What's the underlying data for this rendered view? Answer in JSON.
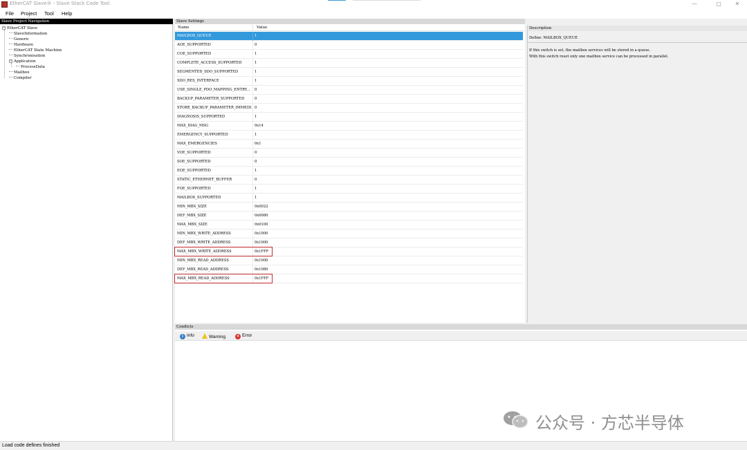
{
  "window": {
    "title": "EtherCAT Slave® - Slave Stack Code Tool",
    "controls": [
      "—",
      "□",
      "✕"
    ]
  },
  "menu": {
    "file": "File",
    "project": "Project",
    "tool": "Tool",
    "help": "Help"
  },
  "nav": {
    "header": "Slave Project Navigation",
    "items": [
      {
        "label": "EtherCAT Slave",
        "level": 0,
        "expander": "−"
      },
      {
        "label": "SlaveInformation",
        "level": 1
      },
      {
        "label": "Generic",
        "level": 1
      },
      {
        "label": "Hardware",
        "level": 1
      },
      {
        "label": "EtherCAT State Machine",
        "level": 1
      },
      {
        "label": "Synchronisation",
        "level": 1
      },
      {
        "label": "Application",
        "level": 1,
        "expander": "−"
      },
      {
        "label": "ProcessData",
        "level": 2
      },
      {
        "label": "Mailbox",
        "level": 1
      },
      {
        "label": "Compiler",
        "level": 1
      }
    ]
  },
  "settings": {
    "header": "Slave Settings",
    "col_name": "Name",
    "col_value": "Value",
    "rows": [
      {
        "name": "MAILBOX_QUEUE",
        "value": "1",
        "selected": true
      },
      {
        "name": "AOE_SUPPORTED",
        "value": "0"
      },
      {
        "name": "COE_SUPPORTED",
        "value": "1"
      },
      {
        "name": "COMPLETE_ACCESS_SUPPORTED",
        "value": "1"
      },
      {
        "name": "SEGMENTED_SDO_SUPPORTED",
        "value": "1"
      },
      {
        "name": "SDO_RES_INTERFACE",
        "value": "1"
      },
      {
        "name": "USE_SINGLE_PDO_MAPPING_ENTRY...",
        "value": "0"
      },
      {
        "name": "BACKUP_PARAMETER_SUPPORTED",
        "value": "0"
      },
      {
        "name": "STORE_BACKUP_PARAMETER_IMMEDI...",
        "value": "0"
      },
      {
        "name": "DIAGNOSIS_SUPPORTED",
        "value": "1"
      },
      {
        "name": "MAX_DIAG_MSG",
        "value": "0x14"
      },
      {
        "name": "EMERGENCY_SUPPORTED",
        "value": "1"
      },
      {
        "name": "MAX_EMERGENCIES",
        "value": "0x1"
      },
      {
        "name": "VOE_SUPPORTED",
        "value": "0"
      },
      {
        "name": "SOE_SUPPORTED",
        "value": "0"
      },
      {
        "name": "EOE_SUPPORTED",
        "value": "1"
      },
      {
        "name": "STATIC_ETHERNET_BUFFER",
        "value": "0"
      },
      {
        "name": "FOE_SUPPORTED",
        "value": "1"
      },
      {
        "name": "MAILBOX_SUPPORTED",
        "value": "1"
      },
      {
        "name": "MIN_MBX_SIZE",
        "value": "0x0022"
      },
      {
        "name": "DEF_MBX_SIZE",
        "value": "0x0080"
      },
      {
        "name": "MAX_MBX_SIZE",
        "value": "0x0100"
      },
      {
        "name": "MIN_MBX_WRITE_ADDRESS",
        "value": "0x1000"
      },
      {
        "name": "DEF_MBX_WRITE_ADDRESS",
        "value": "0x1000"
      },
      {
        "name": "MAX_MBX_WRITE_ADDRESS",
        "value": "0x1FFF",
        "highlighted": true
      },
      {
        "name": "MIN_MBX_READ_ADDRESS",
        "value": "0x1000"
      },
      {
        "name": "DEF_MBX_READ_ADDRESS",
        "value": "0x1080"
      },
      {
        "name": "MAX_MBX_READ_ADDRESS",
        "value": "0x1FFF",
        "highlighted": true
      }
    ]
  },
  "description": {
    "header": "Description",
    "define": "Define: MAILBOX_QUEUE",
    "line1": "If this switch is set, the mailbox services will be stored in a queue.",
    "line2": "With this switch reset only one mailbox service can be processed in parallel."
  },
  "conflicts": {
    "header": "Conflicts",
    "info": "Info",
    "warning": "Warning",
    "error": "Error"
  },
  "watermark": {
    "text": "公众号 · 方芯半导体"
  },
  "status": {
    "text": "Load code defines finished"
  },
  "colors": {
    "selection": "#3399dd",
    "highlight_box": "#c0282a",
    "nav_header_bg": "#000000"
  }
}
